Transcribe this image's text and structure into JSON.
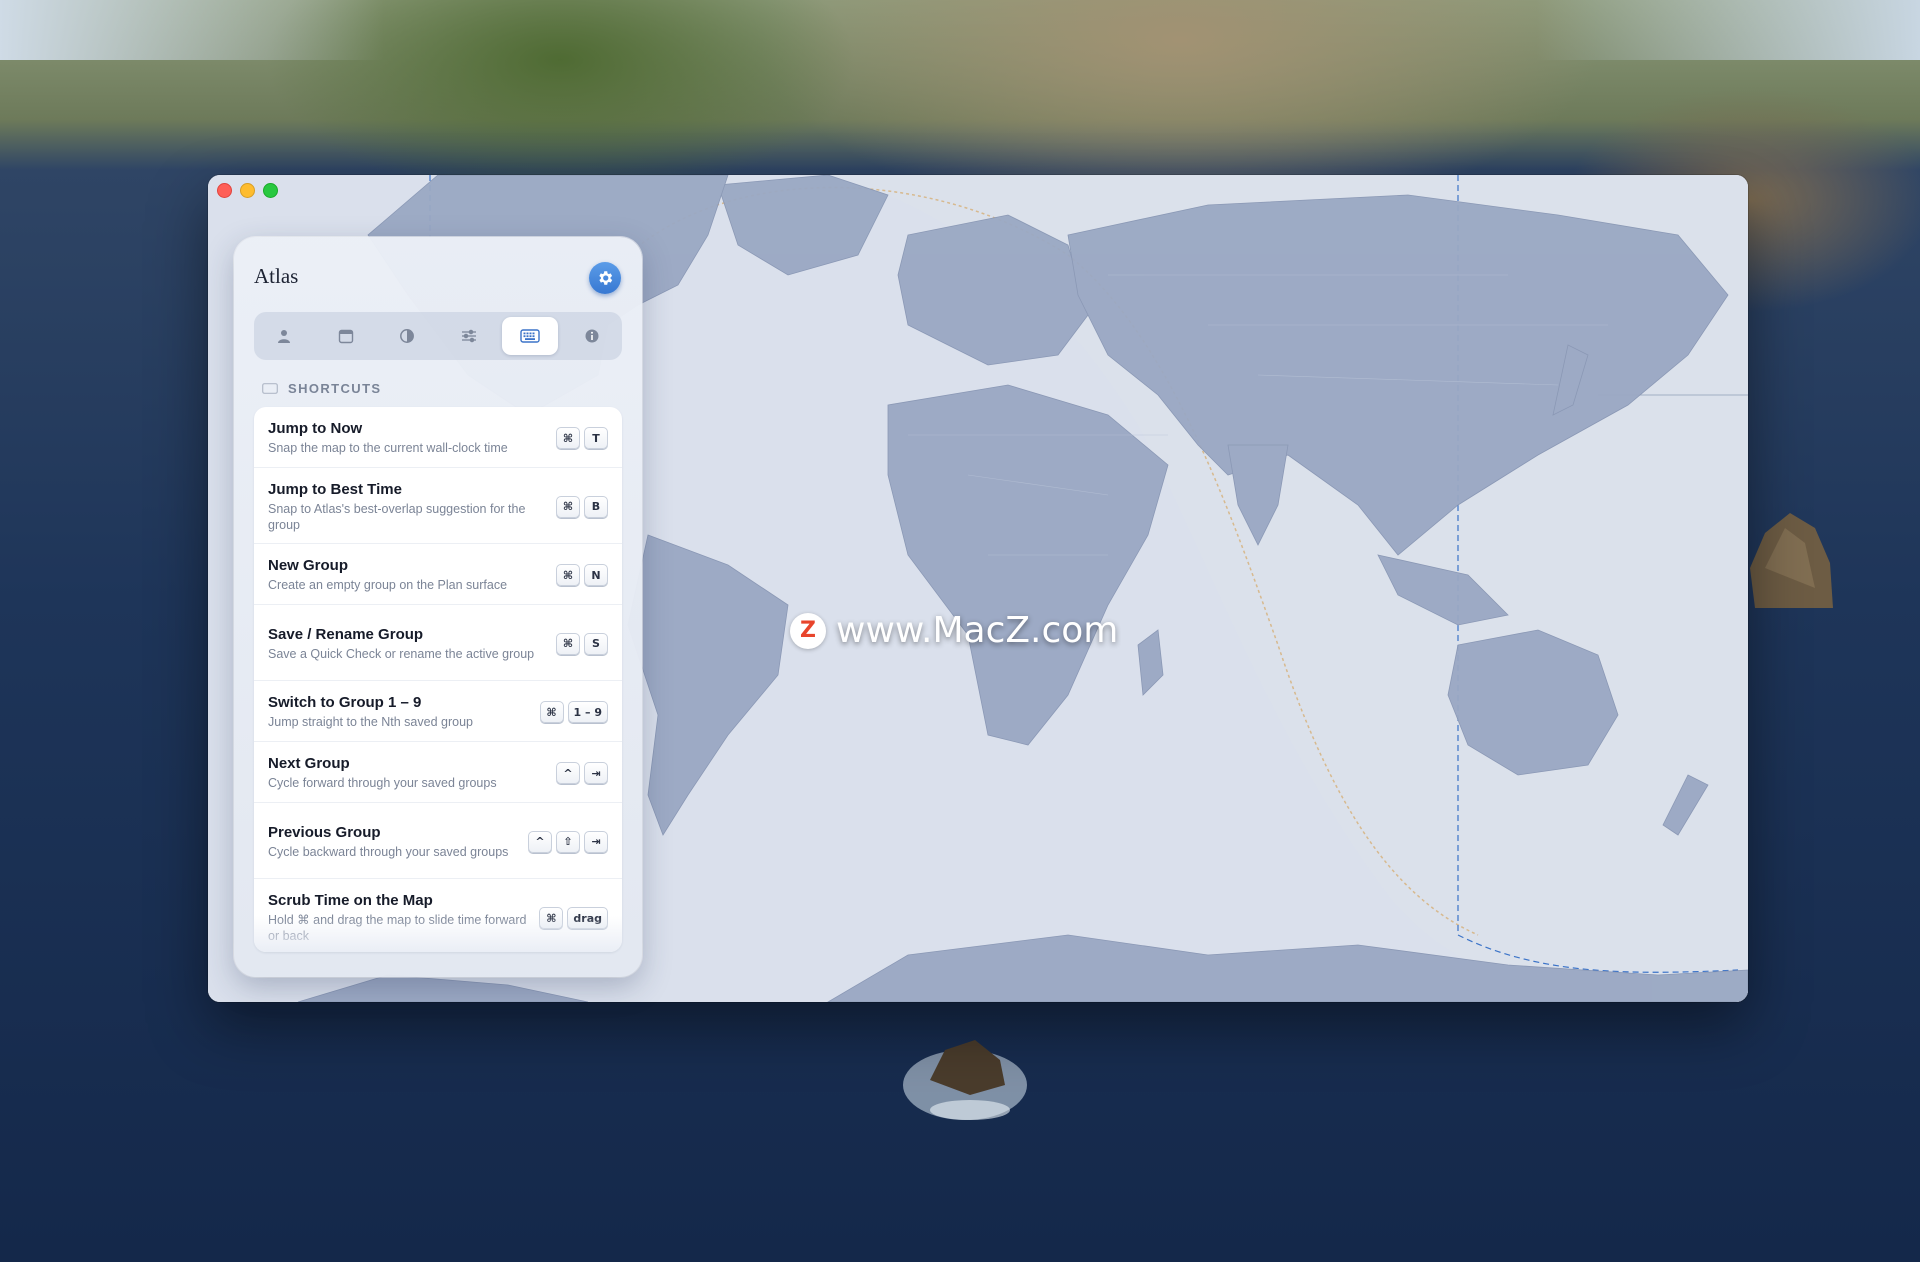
{
  "app": {
    "title": "Atlas"
  },
  "tabs": [
    {
      "name": "people",
      "icon": "person-icon"
    },
    {
      "name": "calendar",
      "icon": "calendar-icon"
    },
    {
      "name": "appearance",
      "icon": "contrast-icon"
    },
    {
      "name": "adjustments",
      "icon": "sliders-icon"
    },
    {
      "name": "shortcuts",
      "icon": "keyboard-icon",
      "active": true
    },
    {
      "name": "about",
      "icon": "info-icon"
    }
  ],
  "section": {
    "title": "SHORTCUTS"
  },
  "shortcuts": [
    {
      "title": "Jump to Now",
      "desc": "Snap the map to the current wall-clock time",
      "keys": [
        "⌘",
        "T"
      ]
    },
    {
      "title": "Jump to Best Time",
      "desc": "Snap to Atlas's best-overlap suggestion for the group",
      "keys": [
        "⌘",
        "B"
      ]
    },
    {
      "title": "New Group",
      "desc": "Create an empty group on the Plan surface",
      "keys": [
        "⌘",
        "N"
      ]
    },
    {
      "title": "Save / Rename Group",
      "desc": "Save a Quick Check or rename the active group",
      "keys": [
        "⌘",
        "S"
      ]
    },
    {
      "title": "Switch to Group 1 – 9",
      "desc": "Jump straight to the Nth saved group",
      "keys": [
        "⌘",
        "1 – 9"
      ]
    },
    {
      "title": "Next Group",
      "desc": "Cycle forward through your saved groups",
      "keys": [
        "^",
        "⇥"
      ]
    },
    {
      "title": "Previous Group",
      "desc": "Cycle backward through your saved groups",
      "keys": [
        "^",
        "⇧",
        "⇥"
      ]
    },
    {
      "title": "Scrub Time on the Map",
      "desc": "Hold ⌘ and drag the map to slide time forward or back",
      "keys": [
        "⌘",
        "drag"
      ]
    }
  ],
  "watermark": {
    "text": "www.MacZ.com",
    "logo_letter": "Z"
  },
  "colors": {
    "accent": "#3778d2",
    "map_land": "#9aa8c3",
    "map_ocean": "#e3e8f0",
    "terminator": "#d7b98e"
  }
}
